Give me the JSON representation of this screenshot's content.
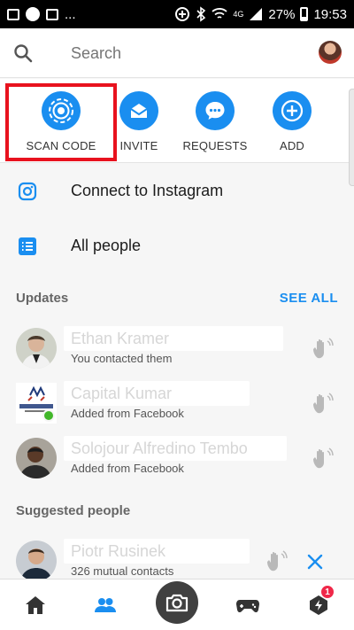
{
  "status_bar": {
    "notif_more": "...",
    "network": "4G",
    "battery": "27%",
    "time": "19:53"
  },
  "search": {
    "placeholder": "Search"
  },
  "actions": [
    {
      "label": "SCAN CODE",
      "icon": "scan-code-icon"
    },
    {
      "label": "INVITE",
      "icon": "invite-icon"
    },
    {
      "label": "REQUESTS",
      "icon": "requests-icon"
    },
    {
      "label": "ADD",
      "icon": "add-icon"
    }
  ],
  "links": {
    "instagram": "Connect to Instagram",
    "all_people": "All people"
  },
  "updates": {
    "title": "Updates",
    "see_all": "SEE ALL",
    "people": [
      {
        "name": "Ethan Kramer",
        "subtitle": "You contacted them"
      },
      {
        "name": "Capital Kumar",
        "subtitle": "Added from Facebook"
      },
      {
        "name": "Solojour Alfredino Tembo",
        "subtitle": "Added from Facebook"
      }
    ]
  },
  "suggested": {
    "title": "Suggested people",
    "people": [
      {
        "name": "Piotr Rusinek",
        "subtitle": "326 mutual contacts"
      }
    ]
  },
  "bottom_nav": {
    "badge_count": "1"
  },
  "colors": {
    "accent": "#1a8ef0",
    "highlight": "#e8121e",
    "online": "#42b72a",
    "badge": "#f02849"
  }
}
